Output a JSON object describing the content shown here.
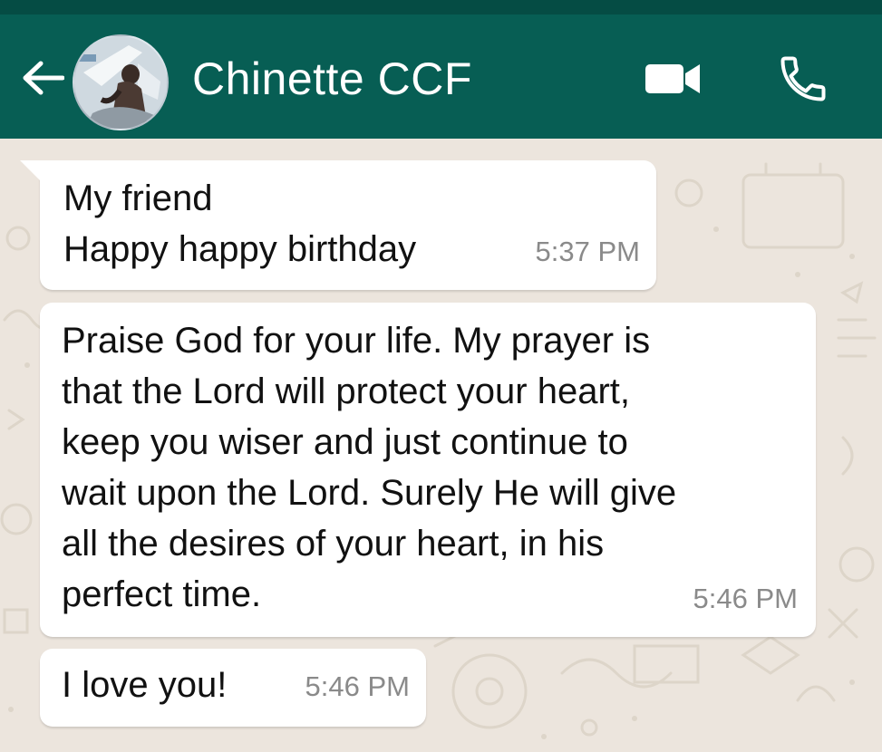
{
  "header": {
    "contact_name": "Chinette CCF",
    "back_icon": "arrow-left-icon",
    "video_icon": "video-camera-icon",
    "phone_icon": "phone-icon",
    "background_color": "#075e54"
  },
  "chat": {
    "wallpaper_color": "#ece5dd",
    "messages": [
      {
        "text": "My friend\nHappy happy birthday",
        "time": "5:37 PM"
      },
      {
        "text": "Praise God for your life. My prayer is\nthat the Lord will protect your heart,\nkeep you wiser and just continue to\nwait upon the Lord. Surely He will give\nall the desires of your heart, in his\nperfect time.",
        "time": "5:46 PM"
      },
      {
        "text": "I love you!",
        "time": "5:46 PM"
      }
    ]
  }
}
